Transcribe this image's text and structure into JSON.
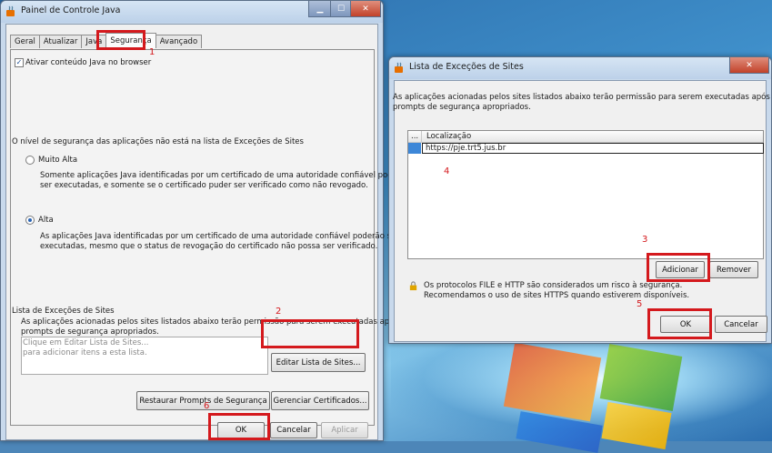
{
  "left_window": {
    "title": "Painel de Controle Java",
    "tabs": [
      "Geral",
      "Atualizar",
      "Java",
      "Segurança",
      "Avançado"
    ],
    "enable_checkbox": "Ativar conteúdo Java no browser",
    "security_level_heading": "O nível de segurança das aplicações não está na lista de Exceções de Sites",
    "very_high": {
      "label": "Muito Alta",
      "desc_line1": "Somente aplicações Java identificadas por um certificado de uma autoridade confiável poderão",
      "desc_line2": "ser executadas, e somente se o certificado puder ser verificado como não revogado."
    },
    "high": {
      "label": "Alta",
      "desc_line1": "As aplicações Java identificadas por um certificado de uma autoridade confiável poderão ser",
      "desc_line2": "executadas, mesmo que o status de revogação do certificado não possa ser verificado."
    },
    "exception_list": {
      "heading": "Lista de Exceções de Sites",
      "desc_line1": "As aplicações acionadas pelos sites listados abaixo terão permissão para serem executadas após os",
      "desc_line2": "prompts de segurança apropriados.",
      "placeholder_line1": "Clique em Editar Lista de Sites...",
      "placeholder_line2": "para adicionar itens a esta lista.",
      "edit_button": "Editar Lista de Sites..."
    },
    "restore_button": "Restaurar Prompts de Segurança",
    "certificates_button": "Gerenciar Certificados...",
    "ok": "OK",
    "cancel": "Cancelar",
    "apply": "Aplicar"
  },
  "right_window": {
    "title": "Lista de Exceções de Sites",
    "desc_line1": "As aplicações acionadas pelos sites listados abaixo terão permissão para serem executadas após os",
    "desc_line2": "prompts de segurança apropriados.",
    "column_dots": "...",
    "column_location": "Localização",
    "url_value": "https://pje.trt5.jus.br",
    "add_button": "Adicionar",
    "remove_button": "Remover",
    "warning_line1": "Os protocolos FILE e HTTP são considerados um risco à segurança.",
    "warning_line2": "Recomendamos o uso de sites HTTPS quando estiverem disponíveis.",
    "ok": "OK",
    "cancel": "Cancelar"
  },
  "annotations": [
    "1",
    "2",
    "3",
    "4",
    "5",
    "6"
  ],
  "colors": {
    "annotation": "#d4191d",
    "titlebar": "#c8d9ec",
    "close": "#c2422a"
  }
}
